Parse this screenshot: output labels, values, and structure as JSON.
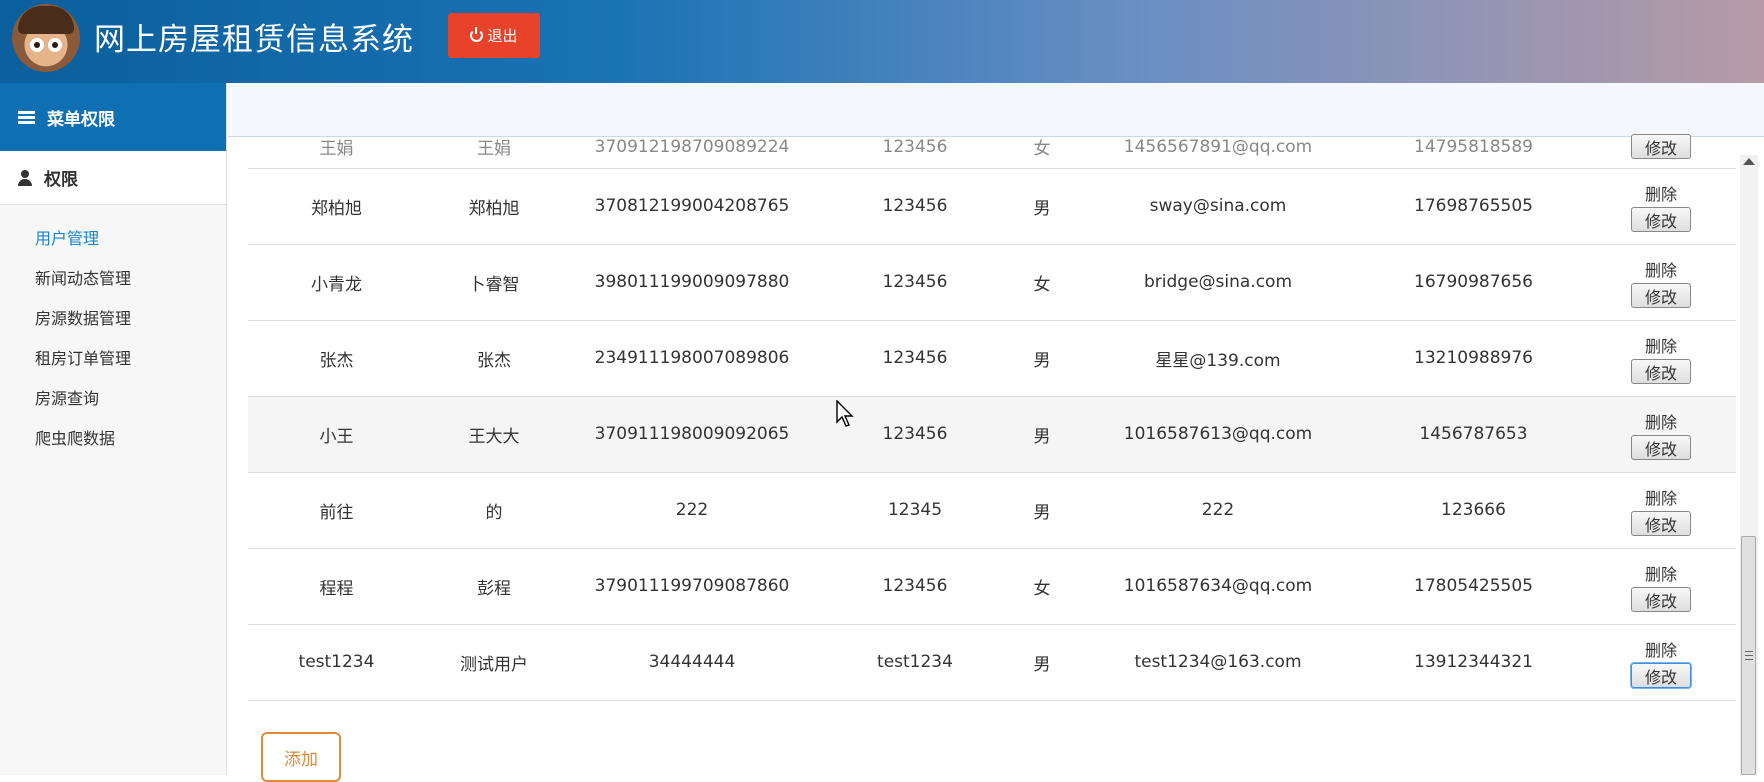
{
  "header": {
    "title": "网上房屋租赁信息系统",
    "logout_label": "退出"
  },
  "sidebar": {
    "menu_title": "菜单权限",
    "section_title": "权限",
    "items": [
      {
        "label": "用户管理",
        "active": true
      },
      {
        "label": "新闻动态管理"
      },
      {
        "label": "房源数据管理"
      },
      {
        "label": "租房订单管理"
      },
      {
        "label": "房源查询"
      },
      {
        "label": "爬虫爬数据"
      }
    ]
  },
  "table": {
    "delete_label": "删除",
    "edit_label": "修改",
    "partial_row": [
      "王娟",
      "王娟",
      "370912198709089224",
      "123456",
      "女",
      "1456567891@qq.com",
      "14795818589"
    ],
    "rows": [
      [
        "郑柏旭",
        "郑柏旭",
        "370812199004208765",
        "123456",
        "男",
        "sway@sina.com",
        "17698765505"
      ],
      [
        "小青龙",
        "卜睿智",
        "398011199009097880",
        "123456",
        "女",
        "bridge@sina.com",
        "16790987656"
      ],
      [
        "张杰",
        "张杰",
        "234911198007089806",
        "123456",
        "男",
        "星星@139.com",
        "13210988976"
      ],
      [
        "小王",
        "王大大",
        "370911198009092065",
        "123456",
        "男",
        "1016587613@qq.com",
        "1456787653"
      ],
      [
        "前往",
        "的",
        "222",
        "12345",
        "男",
        "222",
        "123666"
      ],
      [
        "程程",
        "彭程",
        "379011199709087860",
        "123456",
        "女",
        "1016587634@qq.com",
        "17805425505"
      ],
      [
        "test1234",
        "测试用户",
        "34444444",
        "test1234",
        "男",
        "test1234@163.com",
        "13912344321"
      ]
    ]
  },
  "add_label": "添加"
}
